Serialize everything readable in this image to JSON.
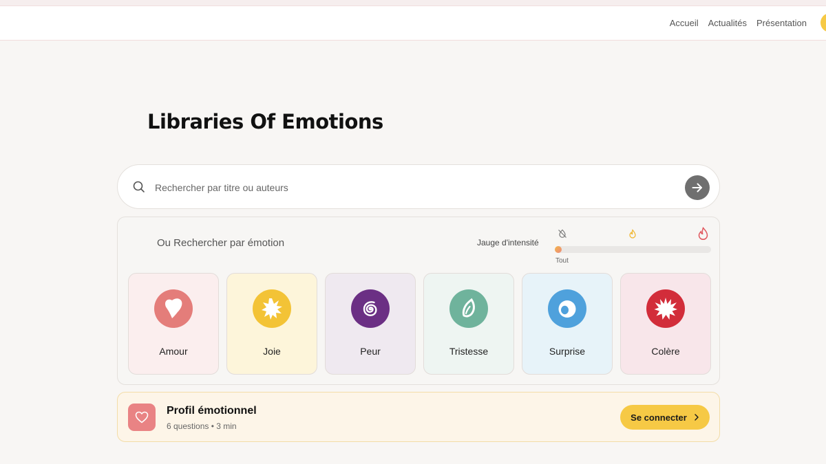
{
  "nav": {
    "links": [
      "Accueil",
      "Actualités",
      "Présentation"
    ]
  },
  "page_title": "Libraries Of Emotions",
  "search": {
    "placeholder": "Rechercher par titre ou auteurs",
    "value": ""
  },
  "emotion_search": {
    "heading": "Ou Rechercher par émotion",
    "gauge": {
      "label": "Jauge d'intensité",
      "value_label": "Tout",
      "level": 0,
      "icons": [
        "no-intensity-icon",
        "small-flame-icon",
        "large-flame-icon"
      ]
    },
    "emotions": [
      {
        "label": "Amour",
        "icon": "heart-shape-icon",
        "color": "#e47d7a",
        "bg": "#fbeeee"
      },
      {
        "label": "Joie",
        "icon": "starburst-icon",
        "color": "#f3c336",
        "bg": "#fdf5da"
      },
      {
        "label": "Peur",
        "icon": "spiral-icon",
        "color": "#6b2f84",
        "bg": "#efe9f0"
      },
      {
        "label": "Tristesse",
        "icon": "drop-icon",
        "color": "#6fb39c",
        "bg": "#eef5f2"
      },
      {
        "label": "Surprise",
        "icon": "eye-icon",
        "color": "#4fa1dc",
        "bg": "#e7f3f9"
      },
      {
        "label": "Colère",
        "icon": "explosion-icon",
        "color": "#d22d3a",
        "bg": "#f8e6ea"
      }
    ]
  },
  "profile": {
    "title": "Profil émotionnel",
    "meta": "6 questions • 3 min",
    "button_label": "Se connecter",
    "icon": "heart-outline-icon"
  },
  "colors": {
    "accent": "#f6c945",
    "background": "#f8f6f4"
  }
}
